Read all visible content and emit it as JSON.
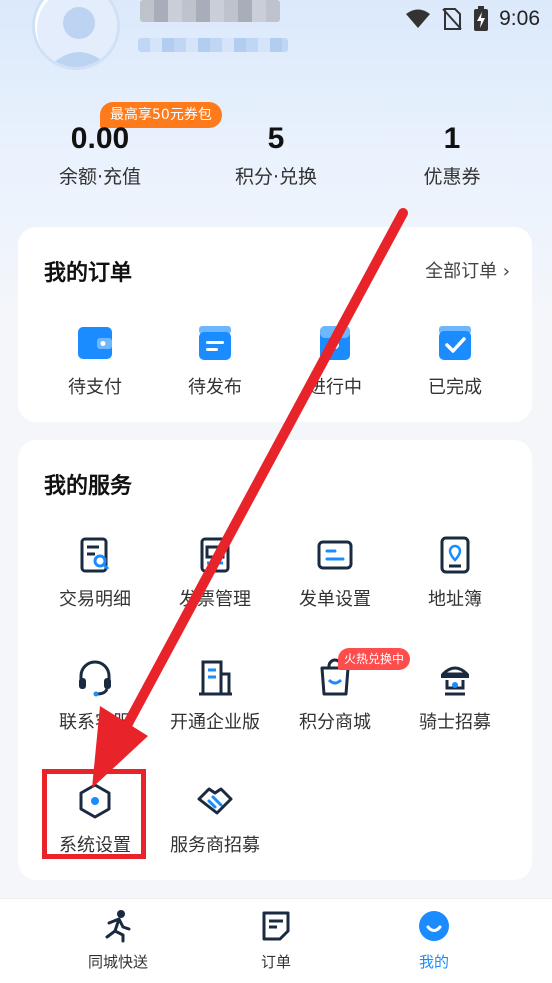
{
  "status_bar": {
    "time": "9:06"
  },
  "stats": [
    {
      "value": "0.00",
      "label": "余额·充值"
    },
    {
      "value": "5",
      "label": "积分·兑换"
    },
    {
      "value": "1",
      "label": "优惠券"
    }
  ],
  "promo_badge": "最高享50元券包",
  "orders": {
    "title": "我的订单",
    "see_all": "全部订单 ›",
    "items": [
      {
        "label": "待支付",
        "icon": "wallet-icon"
      },
      {
        "label": "待发布",
        "icon": "publish-icon"
      },
      {
        "label": "进行中",
        "icon": "in-progress-icon"
      },
      {
        "label": "已完成",
        "icon": "completed-icon"
      }
    ]
  },
  "services": {
    "title": "我的服务",
    "items": [
      {
        "label": "交易明细",
        "icon": "transaction-icon"
      },
      {
        "label": "发票管理",
        "icon": "invoice-icon"
      },
      {
        "label": "发单设置",
        "icon": "order-settings-icon"
      },
      {
        "label": "地址簿",
        "icon": "address-book-icon"
      },
      {
        "label": "联系客服",
        "icon": "headset-icon"
      },
      {
        "label": "开通企业版",
        "icon": "enterprise-icon"
      },
      {
        "label": "积分商城",
        "icon": "shopping-bag-icon"
      },
      {
        "label": "骑士招募",
        "icon": "rider-icon"
      },
      {
        "label": "系统设置",
        "icon": "settings-hexagon-icon"
      },
      {
        "label": "服务商招募",
        "icon": "handshake-icon"
      }
    ],
    "hot_badge": "火热兑换中"
  },
  "tabbar": [
    {
      "label": "同城快送",
      "icon": "runner-icon"
    },
    {
      "label": "订单",
      "icon": "order-icon"
    },
    {
      "label": "我的",
      "icon": "profile-icon"
    }
  ],
  "colors": {
    "accent": "#1a8cff",
    "promo": "#ff7a1a",
    "hot": "#ff4d4d",
    "annotation_red": "#e8232a"
  }
}
